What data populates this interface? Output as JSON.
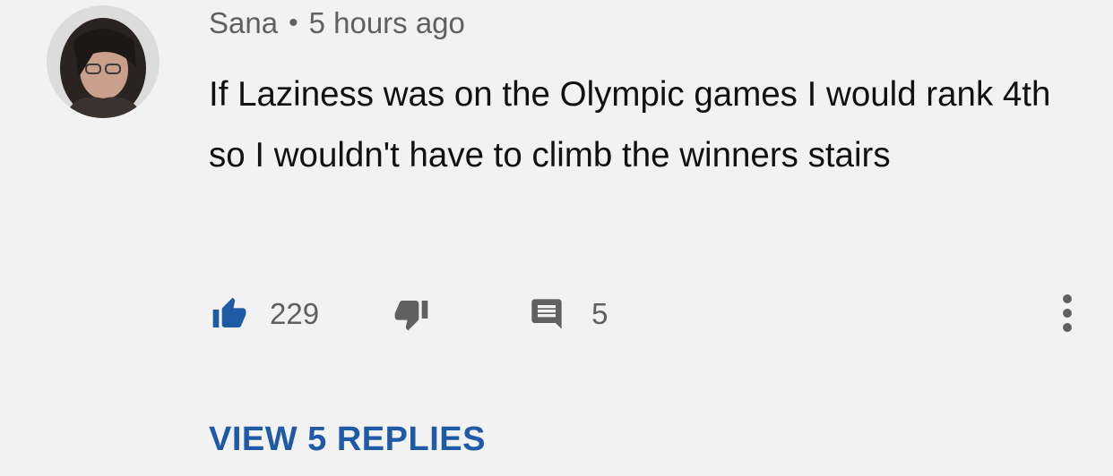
{
  "comment": {
    "author": "Sana",
    "separator": "•",
    "timestamp": "5 hours ago",
    "text": "If Laziness was on the Olympic games I would rank 4th so I wouldn't have to climb the winners stairs",
    "avatar_icon": "profile-photo"
  },
  "actions": {
    "like_icon": "thumbs-up-icon",
    "like_count": "229",
    "like_active_color": "#1e5aa6",
    "dislike_icon": "thumbs-down-icon",
    "reply_icon": "comment-icon",
    "reply_count": "5",
    "more_icon": "more-vertical-icon"
  },
  "replies": {
    "view_label": "VIEW 5 REPLIES",
    "color": "#1e5aa6"
  }
}
